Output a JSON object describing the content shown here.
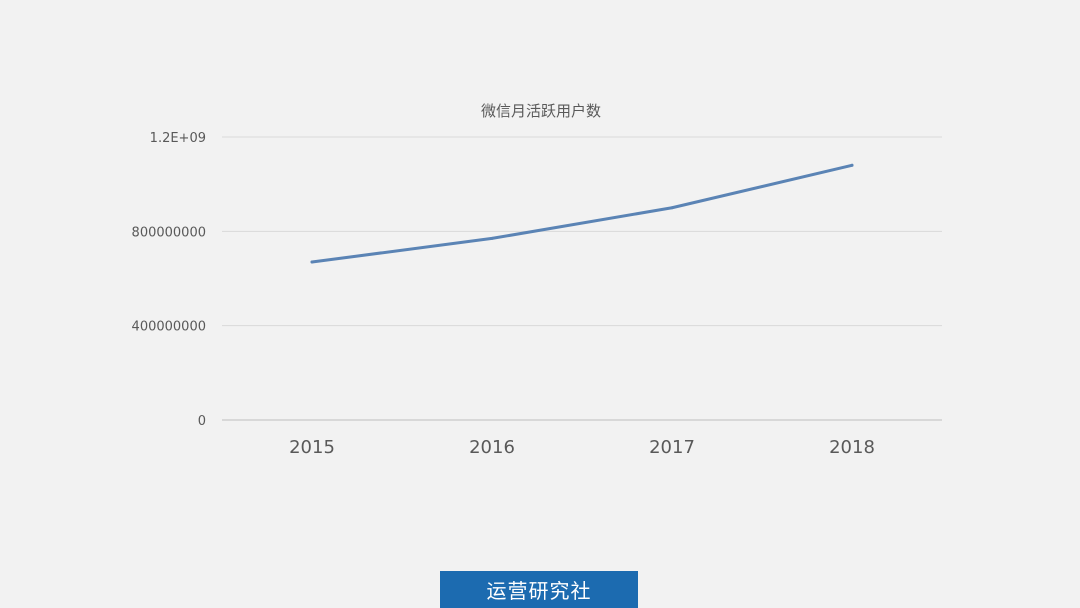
{
  "chart_data": {
    "type": "line",
    "title": "微信月活跃用户数",
    "categories": [
      "2015",
      "2016",
      "2017",
      "2018"
    ],
    "series": [
      {
        "values": [
          670000000,
          770000000,
          900000000,
          1080000000
        ]
      }
    ],
    "y_ticks": [
      0,
      400000000,
      800000000,
      1200000000
    ],
    "y_tick_labels": [
      "0",
      "400000000",
      "800000000",
      "1.2E+09"
    ],
    "ylim": [
      0,
      1200000000
    ],
    "grid": true,
    "colors": {
      "line": "#5b84b5",
      "grid": "#d9d9d9",
      "axis": "#bfbfbf",
      "text": "#595959",
      "background": "#f2f2f2"
    }
  },
  "brand_badge": {
    "label": "运营研究社",
    "color": "#1c6bb0"
  }
}
